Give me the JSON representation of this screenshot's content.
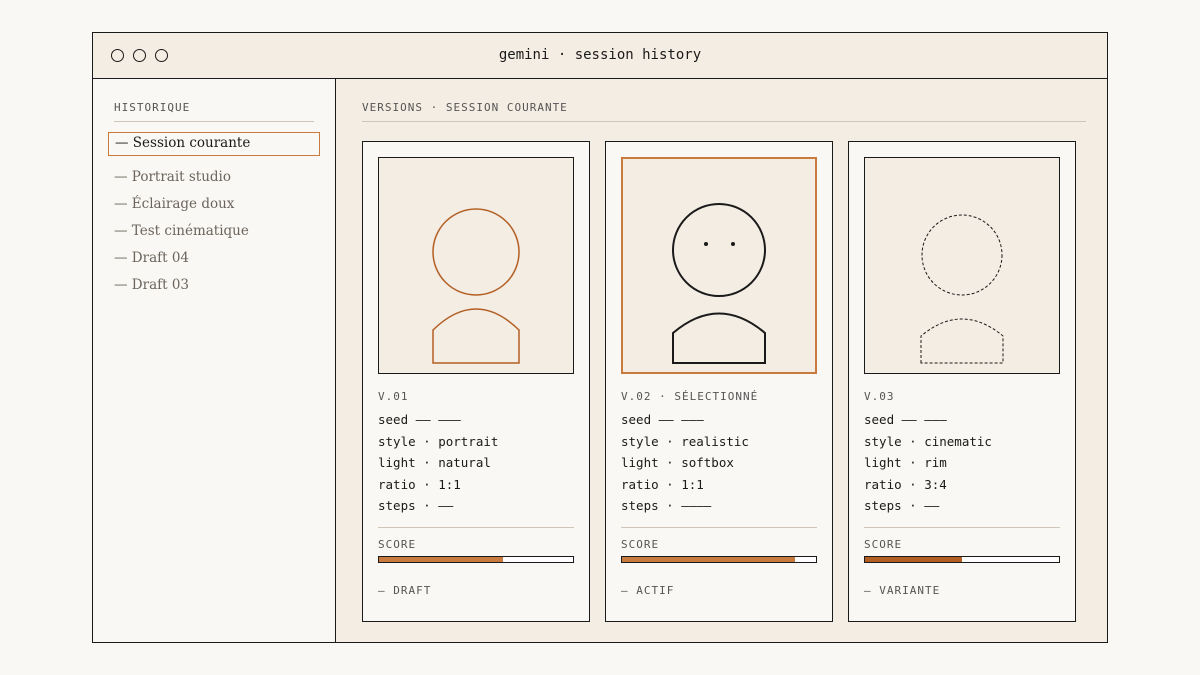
{
  "window": {
    "title": "gemini · session history"
  },
  "sidebar": {
    "heading": "HISTORIQUE",
    "items": [
      {
        "label": "— Session courante",
        "active": true
      },
      {
        "label": "— Portrait studio"
      },
      {
        "label": "— Éclairage doux"
      },
      {
        "label": "— Test cinématique"
      },
      {
        "label": "— Draft 04"
      },
      {
        "label": "— Draft 03"
      }
    ]
  },
  "main": {
    "heading": "VERSIONS · SESSION COURANTE",
    "cards": [
      {
        "version": "V.01",
        "seed": "seed —— ———",
        "style": "style · portrait",
        "light": "light · natural",
        "ratio": "ratio · 1:1",
        "steps": "steps · ——",
        "score_label": "SCORE",
        "score": 0.64,
        "status": "— DRAFT",
        "avatar_style": "outline-orange"
      },
      {
        "version": "V.02 · SÉLECTIONNÉ",
        "seed": "seed —— ———",
        "style": "style · realistic",
        "light": "light · softbox",
        "ratio": "ratio · 1:1",
        "steps": "steps · ————",
        "score_label": "SCORE",
        "score": 0.89,
        "status": "— ACTIF",
        "avatar_style": "solid-dark-with-eyes",
        "selected": true
      },
      {
        "version": "V.03",
        "seed": "seed —— ———",
        "style": "style · cinematic",
        "light": "light · rim",
        "ratio": "ratio · 3:4",
        "steps": "steps · ——",
        "score_label": "SCORE",
        "score": 0.5,
        "status": "— VARIANTE",
        "avatar_style": "dashed"
      }
    ]
  },
  "colors": {
    "accent": "#c97a3f",
    "accent_dark": "#b35f24",
    "ink": "#1a1a1a",
    "panel": "#f4ede3",
    "paper": "#faf8f4"
  },
  "icons": {
    "window_controls": [
      "circle-icon",
      "circle-icon",
      "circle-icon"
    ]
  }
}
